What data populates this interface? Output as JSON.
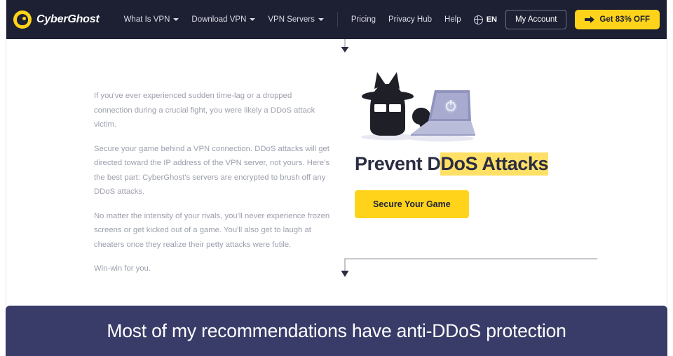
{
  "header": {
    "brand_name": "CyberGhost",
    "brand_icon": "ghost-logo-icon",
    "nav_dropdowns": [
      {
        "label": "What Is VPN",
        "icon": "chevron-down-icon"
      },
      {
        "label": "Download VPN",
        "icon": "chevron-down-icon"
      },
      {
        "label": "VPN Servers",
        "icon": "chevron-down-icon"
      }
    ],
    "nav_links": [
      "Pricing",
      "Privacy Hub",
      "Help"
    ],
    "language": {
      "icon": "globe-icon",
      "label": "EN"
    },
    "account_button": "My Account",
    "offer_button": {
      "label": "Get 83% OFF",
      "icon": "arrow-right-icon"
    },
    "background_color": "#1d1f33",
    "accent_color": "#ffd31a"
  },
  "main": {
    "paragraphs": [
      "If you've ever experienced sudden time-lag or a dropped connection during a crucial fight, you were likely a DDoS attack victim.",
      "Secure your game behind a VPN connection. DDoS attacks will get directed toward the IP address of the VPN server, not yours. Here's the best part: CyberGhost's servers are encrypted to brush off any DDoS attacks.",
      "No matter the intensity of your rivals, you'll never experience frozen screens or get kicked out of a game. You'll also get to laugh at cheaters once they realize their petty attacks were futile.",
      "Win-win for you."
    ],
    "illustration_icon": "ghost-with-laptop-illustration",
    "headline_plain": "Prevent D",
    "headline_highlighted": "DoS Attacks",
    "headline_full": "Prevent DDoS Attacks",
    "cta_button": "Secure Your Game",
    "highlight_color": "#ffe066"
  },
  "annotations": {
    "top_arrow_icon": "down-arrow-connector-icon",
    "bottom_arrow_icon": "elbow-down-arrow-connector-icon",
    "line_color": "#b6b7bd"
  },
  "caption": {
    "text": "Most of my recommendations have anti-DDoS protection",
    "background_color": "#393c68",
    "text_color": "#ffffff"
  }
}
